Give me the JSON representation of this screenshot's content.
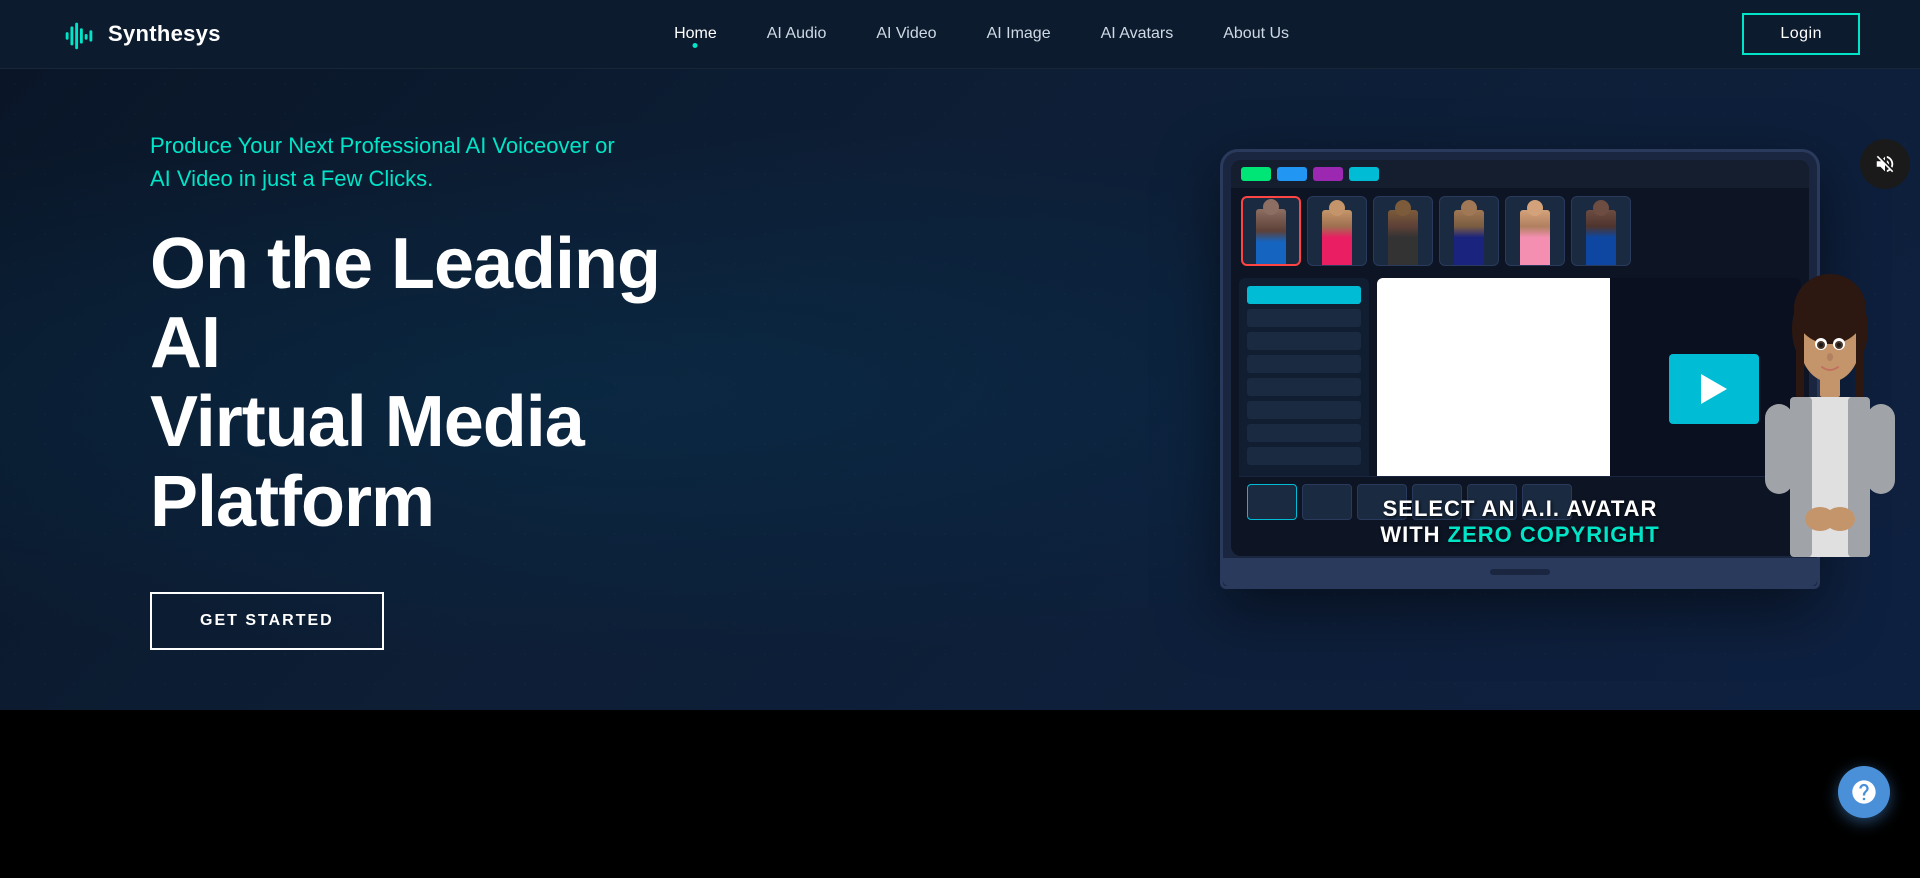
{
  "brand": {
    "name": "Synthesys",
    "logo_alt": "Synthesys logo"
  },
  "nav": {
    "links": [
      {
        "id": "home",
        "label": "Home",
        "active": true
      },
      {
        "id": "ai-audio",
        "label": "AI Audio",
        "active": false
      },
      {
        "id": "ai-video",
        "label": "AI Video",
        "active": false
      },
      {
        "id": "ai-image",
        "label": "AI Image",
        "active": false
      },
      {
        "id": "ai-avatars",
        "label": "AI Avatars",
        "active": false
      },
      {
        "id": "about-us",
        "label": "About Us",
        "active": false
      }
    ],
    "login_label": "Login"
  },
  "hero": {
    "subtitle": "Produce Your Next Professional AI Voiceover or\nAI Video in just a Few Clicks.",
    "title_line1": "On the Leading AI",
    "title_line2": "Virtual Media Platform",
    "cta_label": "GET STARTED",
    "video_overlay": {
      "line1": "SELECT AN A.I. AVATAR",
      "line2_prefix": "WITH ",
      "line2_highlight": "ZERO COPYRIGHT",
      "line2_suffix": ""
    }
  },
  "icons": {
    "mute": "🔇",
    "play": "▶",
    "support": "⊕"
  }
}
